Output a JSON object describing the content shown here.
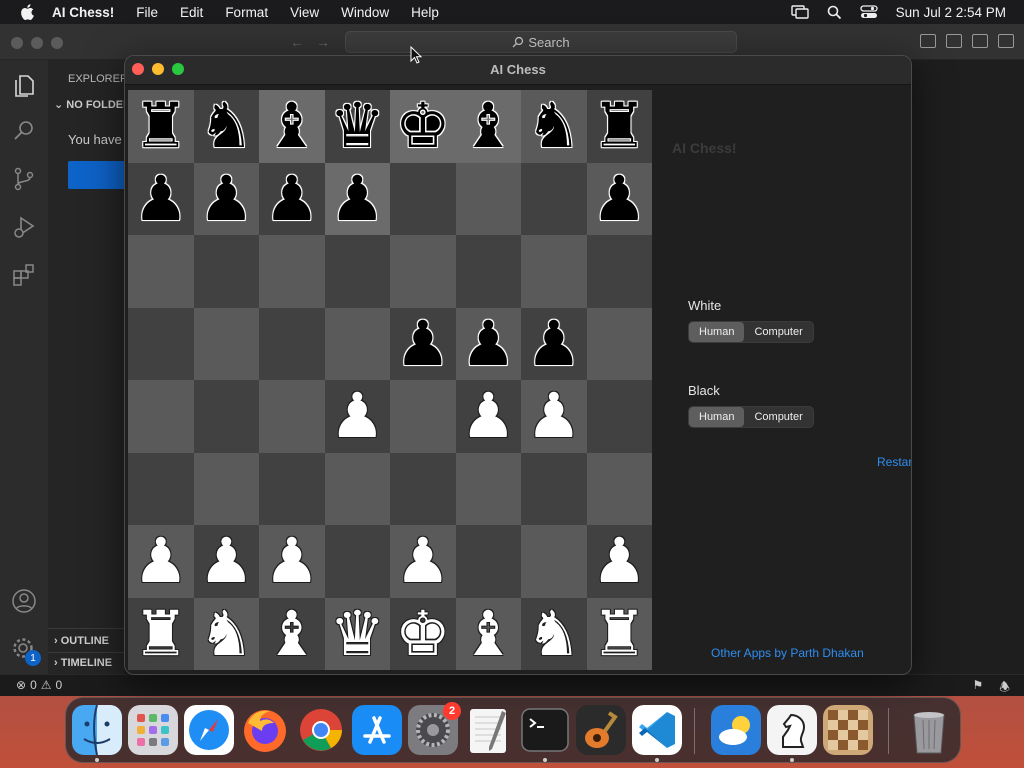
{
  "menubar": {
    "app_name": "AI Chess!",
    "items": [
      "File",
      "Edit",
      "Format",
      "View",
      "Window",
      "Help"
    ],
    "clock": "Sun Jul 2  2:54 PM"
  },
  "vscode": {
    "search_label": "Search",
    "explorer_label": "EXPLORER",
    "no_folder_label": "NO FOLDER",
    "you_have_text": "You have",
    "outline_label": "OUTLINE",
    "timeline_label": "TIMELINE",
    "errors_count": "0",
    "warnings_count": "0",
    "accounts_badge": "1"
  },
  "chess_window": {
    "title": "AI Chess",
    "board": [
      [
        "bR",
        "bN",
        "bB",
        "bQ",
        "bK",
        "bB",
        "bN",
        "bR"
      ],
      [
        "bP",
        "bP",
        "bP",
        "bP",
        "",
        "",
        "",
        "bP"
      ],
      [
        "",
        "",
        "",
        "",
        "",
        "",
        "",
        ""
      ],
      [
        "",
        "",
        "",
        "",
        "bP",
        "bP",
        "bP",
        ""
      ],
      [
        "",
        "",
        "",
        "wP",
        "",
        "wP",
        "wP",
        ""
      ],
      [
        "",
        "",
        "",
        "",
        "",
        "",
        "",
        ""
      ],
      [
        "wP",
        "wP",
        "wP",
        "",
        "wP",
        "",
        "",
        "wP"
      ],
      [
        "wR",
        "wN",
        "wB",
        "wQ",
        "wK",
        "wB",
        "wN",
        "wR"
      ]
    ],
    "highlighted_squares": [
      [
        0,
        2
      ],
      [
        0,
        4
      ],
      [
        0,
        5
      ],
      [
        1,
        3
      ]
    ],
    "panel": {
      "title": "AI Chess!",
      "white_label": "White",
      "black_label": "Black",
      "human_label": "Human",
      "computer_label": "Computer",
      "white_selected": "Human",
      "black_selected": "Human",
      "restart_label": "Restart game",
      "other_apps_label": "Other Apps by Parth Dhakan"
    }
  },
  "dock": {
    "apps": [
      {
        "name": "Finder",
        "icon": "finder-icon"
      },
      {
        "name": "Launchpad",
        "icon": "launchpad-icon"
      },
      {
        "name": "Safari",
        "icon": "safari-icon"
      },
      {
        "name": "Firefox",
        "icon": "firefox-icon"
      },
      {
        "name": "Chrome",
        "icon": "chrome-icon"
      },
      {
        "name": "App Store",
        "icon": "appstore-icon"
      },
      {
        "name": "System Settings",
        "icon": "settings-icon",
        "badge": "2"
      },
      {
        "name": "TextEdit",
        "icon": "textedit-icon"
      },
      {
        "name": "Terminal",
        "icon": "terminal-icon"
      },
      {
        "name": "GarageBand",
        "icon": "garageband-icon"
      },
      {
        "name": "Visual Studio Code",
        "icon": "vscode-icon"
      },
      {
        "name": "Weather",
        "icon": "weather-icon"
      },
      {
        "name": "AI Chess",
        "icon": "chess-knight-icon"
      },
      {
        "name": "Chess",
        "icon": "chess-board-icon"
      },
      {
        "name": "Trash",
        "icon": "trash-icon"
      }
    ],
    "settings_badge": "2"
  }
}
